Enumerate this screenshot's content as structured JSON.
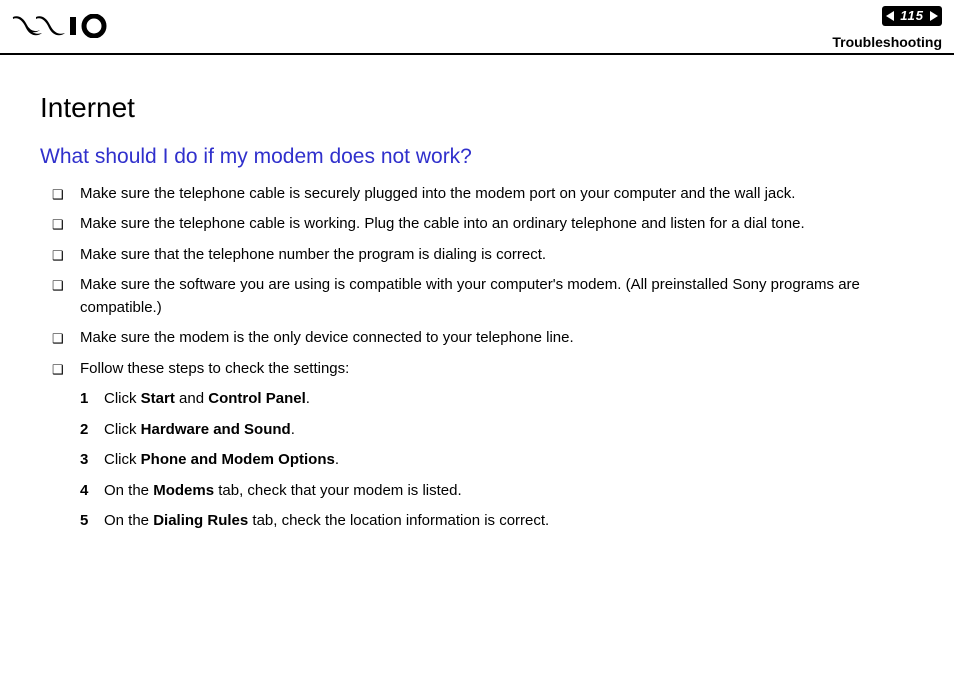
{
  "header": {
    "page_number": "115",
    "section": "Troubleshooting"
  },
  "content": {
    "chapter_title": "Internet",
    "question": "What should I do if my modem does not work?",
    "bullets": [
      "Make sure the telephone cable is securely plugged into the modem port on your computer and the wall jack.",
      "Make sure the telephone cable is working. Plug the cable into an ordinary telephone and listen for a dial tone.",
      "Make sure that the telephone number the program is dialing is correct.",
      "Make sure the software you are using is compatible with your computer's modem. (All preinstalled Sony programs are compatible.)",
      "Make sure the modem is the only device connected to your telephone line.",
      "Follow these steps to check the settings:"
    ],
    "steps": [
      {
        "num": "1",
        "prefix": "Click ",
        "bold1": "Start",
        "mid": " and ",
        "bold2": "Control Panel",
        "suffix": "."
      },
      {
        "num": "2",
        "prefix": "Click ",
        "bold1": "Hardware and Sound",
        "mid": "",
        "bold2": "",
        "suffix": "."
      },
      {
        "num": "3",
        "prefix": "Click ",
        "bold1": "Phone and Modem Options",
        "mid": "",
        "bold2": "",
        "suffix": "."
      },
      {
        "num": "4",
        "prefix": "On the ",
        "bold1": "Modems",
        "mid": "",
        "bold2": "",
        "suffix": " tab, check that your modem is listed."
      },
      {
        "num": "5",
        "prefix": "On the ",
        "bold1": "Dialing Rules",
        "mid": "",
        "bold2": "",
        "suffix": " tab, check the location information is correct."
      }
    ]
  }
}
